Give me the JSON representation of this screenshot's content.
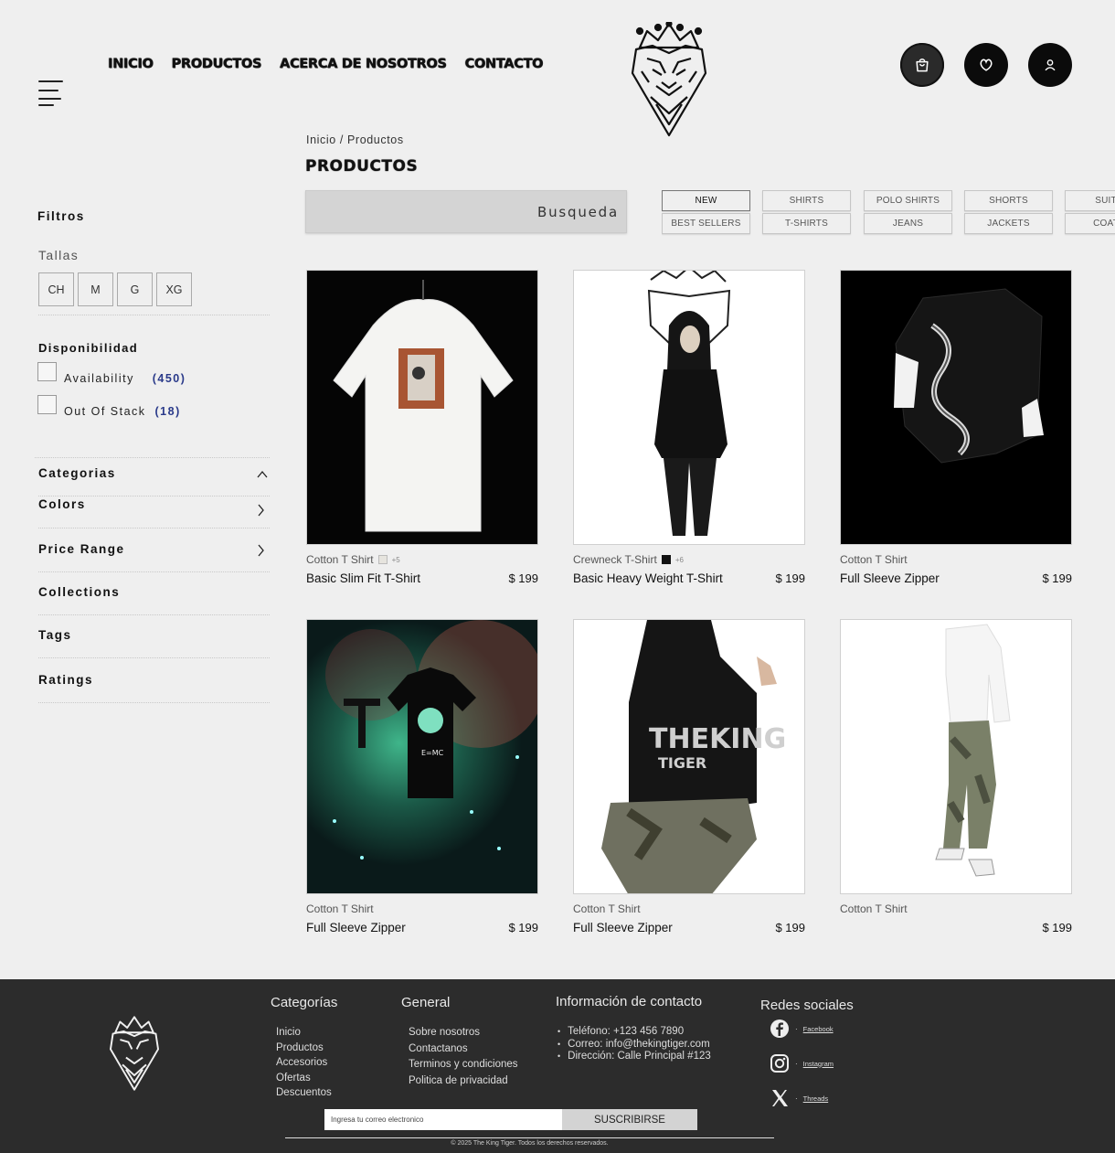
{
  "nav": {
    "menu_icon": "hamburger-menu-icon",
    "links": [
      "INICIO",
      "PRODUCTOS",
      "ACERCA DE NOSOTROS",
      "CONTACTO"
    ]
  },
  "header": {
    "logo_icon": "tiger-crown-logo",
    "actions": [
      {
        "icon": "shopping-bag-icon"
      },
      {
        "icon": "heart-icon"
      },
      {
        "icon": "user-icon"
      }
    ]
  },
  "breadcrumb": {
    "home": "Inicio",
    "separator": " / ",
    "current": "Productos"
  },
  "page": {
    "title": "PRODUCTOS"
  },
  "search": {
    "placeholder": "Busqueda"
  },
  "chips": {
    "row1": [
      "NEW",
      "SHIRTS",
      "POLO SHIRTS",
      "SHORTS",
      "SUITS"
    ],
    "row2": [
      "BEST SELLERS",
      "T-SHIRTS",
      "JEANS",
      "JACKETS",
      "COATS"
    ],
    "active": "NEW"
  },
  "filters": {
    "title": "Filtros",
    "sizes_label": "Tallas",
    "sizes": [
      "CH",
      "M",
      "G",
      "XG"
    ],
    "availability": {
      "title": "Disponibilidad",
      "options": [
        {
          "label": "Availability",
          "count": "(450)"
        },
        {
          "label": "Out Of Stack",
          "count": "(18)"
        }
      ]
    },
    "accordions": [
      {
        "label": "Categorias",
        "icon": "chevron-up-icon"
      },
      {
        "label": "Colors",
        "icon": "chevron-right-icon"
      },
      {
        "label": "Price Range",
        "icon": "chevron-right-icon"
      },
      {
        "label": "Collections",
        "icon": ""
      },
      {
        "label": "Tags",
        "icon": ""
      },
      {
        "label": "Ratings",
        "icon": ""
      }
    ]
  },
  "products": [
    {
      "category": "Cotton T Shirt",
      "swatch": "#e6e4de",
      "more": "+5",
      "name": "Basic Slim Fit T-Shirt",
      "price": "$ 199"
    },
    {
      "category": "Crewneck T-Shirt",
      "swatch": "#111111",
      "more": "+6",
      "name": "Basic Heavy Weight T-Shirt",
      "price": "$ 199"
    },
    {
      "category": "Cotton T Shirt",
      "swatch": "",
      "more": "",
      "name": "Full Sleeve Zipper",
      "price": "$ 199"
    },
    {
      "category": "Cotton T Shirt",
      "swatch": "",
      "more": "",
      "name": "Full Sleeve Zipper",
      "price": "$ 199"
    },
    {
      "category": "Cotton T Shirt",
      "swatch": "",
      "more": "",
      "name": "Full Sleeve Zipper",
      "price": "$ 199"
    },
    {
      "category": "Cotton T Shirt",
      "swatch": "",
      "more": "",
      "name": "",
      "price": "$ 199"
    }
  ],
  "footer": {
    "categories": {
      "title": "Categorías",
      "items": [
        "Inicio",
        "Productos",
        "Accesorios",
        "Ofertas",
        "Descuentos"
      ]
    },
    "general": {
      "title": "General",
      "items": [
        "Sobre nosotros",
        "Contactanos",
        "Terminos y condiciones",
        "Politica de privacidad"
      ]
    },
    "contact": {
      "title": "Información de contacto",
      "items": [
        "Teléfono: +123 456 7890",
        "Correo: info@thekingtiger.com",
        "Dirección: Calle Principal #123"
      ]
    },
    "social": {
      "title": "Redes sociales",
      "items": [
        {
          "icon": "facebook-icon",
          "label": "Facebook"
        },
        {
          "icon": "instagram-icon",
          "label": "Instagram"
        },
        {
          "icon": "x-twitter-icon",
          "label": "Threads"
        }
      ]
    },
    "newsletter": {
      "placeholder": "Ingresa tu correo electronico",
      "button": "SUSCRIBIRSE"
    },
    "copyright": "© 2025 The King Tiger. Todos los derechos reservados."
  }
}
